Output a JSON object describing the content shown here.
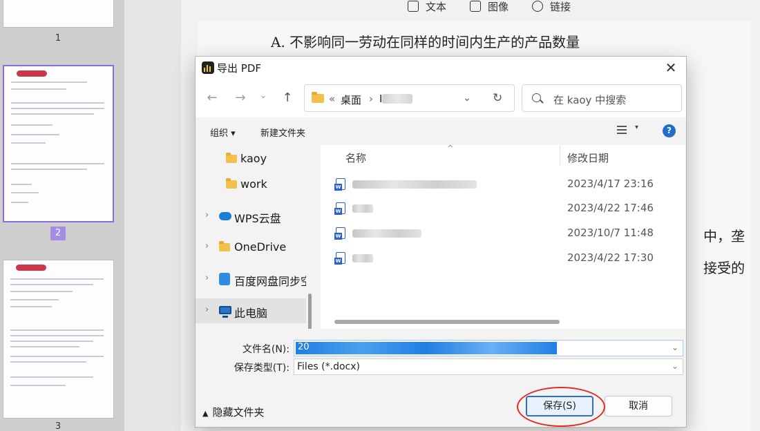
{
  "background": {
    "toolbar": {
      "text": "文本",
      "image": "图像",
      "link": "链接"
    },
    "doc_lines": [
      "A. 不影响同一劳动在同样的时间内生产的产品数量",
      "中，垄",
      "接受的"
    ],
    "thumb_numbers": [
      "1",
      "2",
      "3"
    ]
  },
  "dialog": {
    "title": "导出 PDF",
    "close_label": "✕",
    "nav": {
      "back": "←",
      "forward": "→",
      "recent": "⌄",
      "up": "↑",
      "breadcrumb_sep": "«",
      "breadcrumb_desktop": "桌面",
      "breadcrumb_arrow": "›",
      "breadcrumb_partial": "I",
      "dropdown": "⌄",
      "refresh": "↻",
      "search_placeholder": "在 kaoy 中搜索"
    },
    "commands": {
      "organize": "组织 ▾",
      "new_folder": "新建文件夹",
      "view_drop": "▾",
      "help": "?"
    },
    "tree": [
      {
        "label": "kaoy",
        "type": "folder"
      },
      {
        "label": "work",
        "type": "folder"
      },
      {
        "label": "WPS云盘",
        "type": "cloud",
        "chevron": "›"
      },
      {
        "label": "OneDrive",
        "type": "folder",
        "chevron": "›"
      },
      {
        "label": "百度网盘同步空",
        "type": "baidu",
        "chevron": "›"
      },
      {
        "label": "此电脑",
        "type": "pc",
        "chevron": "›",
        "selected": true
      }
    ],
    "columns": {
      "name": "名称",
      "modified": "修改日期",
      "sort_caret": "^"
    },
    "files": [
      {
        "name": "",
        "date": "2023/4/17 23:16"
      },
      {
        "name": "",
        "date": "2023/4/22 17:46"
      },
      {
        "name": "",
        "date": "2023/10/7 11:48"
      },
      {
        "name": "",
        "date": "2023/4/22 17:30"
      }
    ],
    "form": {
      "filename_label": "文件名(N):",
      "filename_value": "20",
      "filetype_label": "保存类型(T):",
      "filetype_value": "Files (*.docx)",
      "dropdown": "⌄"
    },
    "footer": {
      "hide_folders": "隐藏文件夹",
      "hide_caret": "▲",
      "save": "保存(S)",
      "cancel": "取消"
    }
  }
}
